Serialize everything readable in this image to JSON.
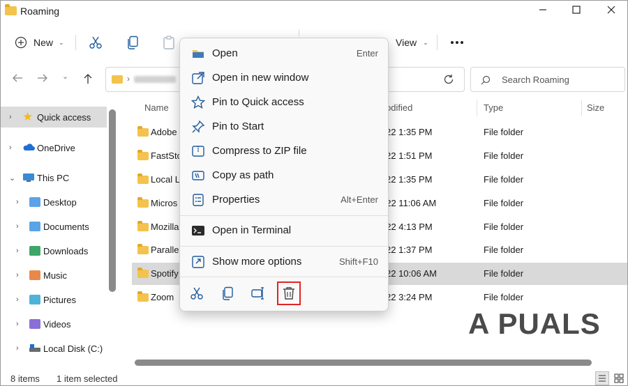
{
  "window": {
    "title": "Roaming"
  },
  "toolbar": {
    "new_label": "New",
    "view_label": "View",
    "more_icon": "ellipsis-icon"
  },
  "search": {
    "placeholder": "Search Roaming"
  },
  "nav": {
    "items": [
      {
        "label": "Quick access"
      },
      {
        "label": "OneDrive"
      },
      {
        "label": "This PC"
      },
      {
        "label": "Desktop"
      },
      {
        "label": "Documents"
      },
      {
        "label": "Downloads"
      },
      {
        "label": "Music"
      },
      {
        "label": "Pictures"
      },
      {
        "label": "Videos"
      },
      {
        "label": "Local Disk (C:)"
      }
    ]
  },
  "columns": {
    "name": "Name",
    "modified": "odified",
    "type": "Type",
    "size": "Size"
  },
  "files": [
    {
      "name": "Adobe",
      "modified": "22 1:35 PM",
      "type": "File folder"
    },
    {
      "name": "FastSto",
      "modified": "22 1:51 PM",
      "type": "File folder"
    },
    {
      "name": "Local L",
      "modified": "22 1:35 PM",
      "type": "File folder"
    },
    {
      "name": "Micros",
      "modified": "022 11:06 AM",
      "type": "File folder"
    },
    {
      "name": "Mozilla",
      "modified": "022 4:13 PM",
      "type": "File folder"
    },
    {
      "name": "Paralle",
      "modified": "22 1:37 PM",
      "type": "File folder"
    },
    {
      "name": "Spotify",
      "modified": "22 10:06 AM",
      "type": "File folder"
    },
    {
      "name": "Zoom",
      "modified": "22 3:24 PM",
      "type": "File folder"
    }
  ],
  "context_menu": {
    "items": [
      {
        "label": "Open",
        "shortcut": "Enter"
      },
      {
        "label": "Open in new window",
        "shortcut": ""
      },
      {
        "label": "Pin to Quick access",
        "shortcut": ""
      },
      {
        "label": "Pin to Start",
        "shortcut": ""
      },
      {
        "label": "Compress to ZIP file",
        "shortcut": ""
      },
      {
        "label": "Copy as path",
        "shortcut": ""
      },
      {
        "label": "Properties",
        "shortcut": "Alt+Enter"
      },
      {
        "label": "Open in Terminal",
        "shortcut": ""
      },
      {
        "label": "Show more options",
        "shortcut": "Shift+F10"
      }
    ]
  },
  "status": {
    "count": "8 items",
    "selected": "1 item selected"
  },
  "watermark": {
    "text": "A  PUALS"
  },
  "colors": {
    "folder": "#f3c34d",
    "accent": "#0067c0",
    "highlight_box": "#e02424"
  }
}
